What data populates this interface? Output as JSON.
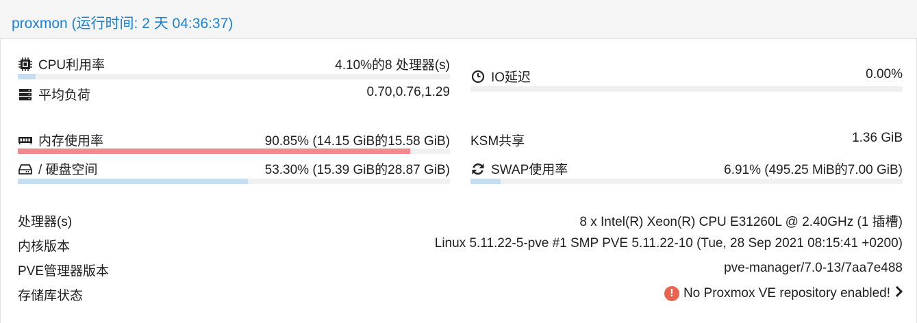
{
  "header": {
    "title": "proxmon (运行时间: 2 天 04:36:37)"
  },
  "stats": {
    "cpu": {
      "label": "CPU利用率",
      "value": "4.10%的8 处理器(s)",
      "percent": 4.1,
      "icon": "cpu-icon"
    },
    "load": {
      "label": "平均负荷",
      "value": "0.70,0.76,1.29",
      "icon": "server-icon"
    },
    "io": {
      "label": "IO延迟",
      "value": "0.00%",
      "percent": 0,
      "icon": "clock-icon"
    },
    "memory": {
      "label": "内存使用率",
      "value": "90.85% (14.15 GiB的15.58 GiB)",
      "percent": 90.85,
      "icon": "memory-icon"
    },
    "ksm": {
      "label": "KSM共享",
      "value": "1.36 GiB"
    },
    "disk": {
      "label": "/ 硬盘空间",
      "value": "53.30% (15.39 GiB的28.87 GiB)",
      "percent": 53.3,
      "icon": "hdd-icon"
    },
    "swap": {
      "label": "SWAP使用率",
      "value": "6.91% (495.25 MiB的7.00 GiB)",
      "percent": 6.91,
      "icon": "refresh-icon"
    }
  },
  "info": [
    {
      "key": "处理器(s)",
      "value": "8 x Intel(R) Xeon(R) CPU E31260L @ 2.40GHz (1 插槽)"
    },
    {
      "key": "内核版本",
      "value": "Linux 5.11.22-5-pve #1 SMP PVE 5.11.22-10 (Tue, 28 Sep 2021 08:15:41 +0200)"
    },
    {
      "key": "PVE管理器版本",
      "value": "pve-manager/7.0-13/7aa7e488"
    },
    {
      "key": "存储库状态",
      "value": "No Proxmox VE repository enabled!"
    }
  ],
  "colors": {
    "accent": "#1a82d4",
    "bar_normal": "#c5def2",
    "bar_danger": "#ef8a8f",
    "warning": "#e8644e"
  }
}
